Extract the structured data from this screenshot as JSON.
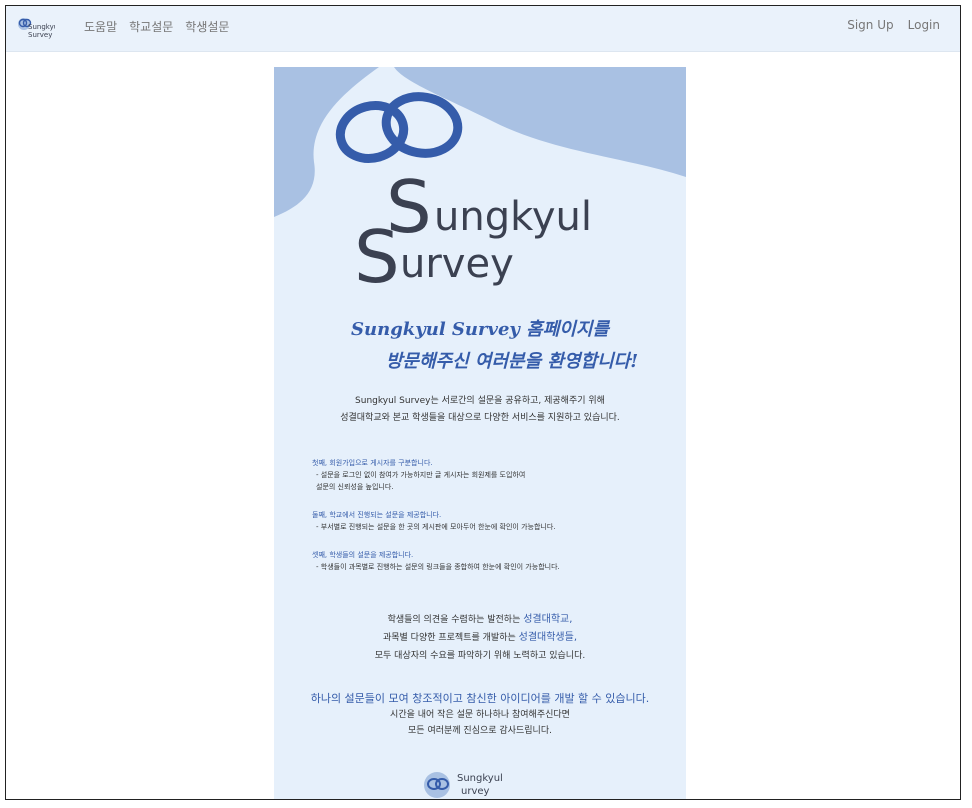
{
  "navbar": {
    "logo_text": [
      "Sungkyul",
      "Survey"
    ],
    "links": [
      "도움말",
      "학교설문",
      "학생설문"
    ],
    "sign_up": "Sign Up",
    "login": "Login"
  },
  "poster": {
    "brand_line1": "ungkyul",
    "brand_line2": "urvey",
    "brand_initial": "S",
    "welcome_line1": "Sungkyul Survey 홈페이지를",
    "welcome_line2": "방문해주신 여러분을 환영합니다!",
    "intro_line1": "Sungkyul Survey는 서로간의 설문을 공유하고, 제공해주기 위해",
    "intro_line2": "성결대학교와 본교 학생들을 대상으로 다양한 서비스를 지원하고 있습니다.",
    "features": [
      {
        "title": "첫째, 회원가입으로 게시자를 구분합니다.",
        "desc": [
          "- 설문을 로그인 없이 참여가 가능하지만 글 게시자는 회원제를 도입하여",
          "  설문의 신뢰성을 높입니다."
        ]
      },
      {
        "title": "둘째, 학교에서 진행되는 설문을 제공합니다.",
        "desc": [
          "- 부서별로 진행되는 설문을 한 곳의 게시판에 모아두어 한눈에 확인이 가능합니다."
        ]
      },
      {
        "title": "셋째, 학생들의 설문을 제공합니다.",
        "desc": [
          "- 학생들이 과목별로 진행하는 설문의 링크들을 종합하여 한눈에 확인이 가능합니다."
        ]
      }
    ],
    "mission_line1_a": "학생들의 의견을 수렴하는 발전하는 ",
    "mission_line1_b": "성결대학교",
    "mission_line1_c": ",",
    "mission_line2_a": "과목별 다양한 프로젝트를 개발하는 ",
    "mission_line2_b": "성결대학생들",
    "mission_line2_c": ",",
    "mission_line3": "모두 대상자의 수요를 파악하기 위해 노력하고 있습니다.",
    "closing_line1": "하나의 설문들이 모여 창조적이고 참신한 아이디어를 개발 할 수 있습니다.",
    "closing_line2": "시간을 내어 작은 설문 하나하나 참여해주신다면",
    "closing_line3": "모든 여러분께 진심으로 감사드립니다.",
    "mini_logo_text": [
      "Sungkyul",
      "urvey"
    ]
  },
  "colors": {
    "navbar_bg": "#eaf2fb",
    "poster_bg": "#e6f0fb",
    "blob": "#a9c1e3",
    "brand_dark": "#3b4151",
    "accent_blue": "#355caa"
  }
}
